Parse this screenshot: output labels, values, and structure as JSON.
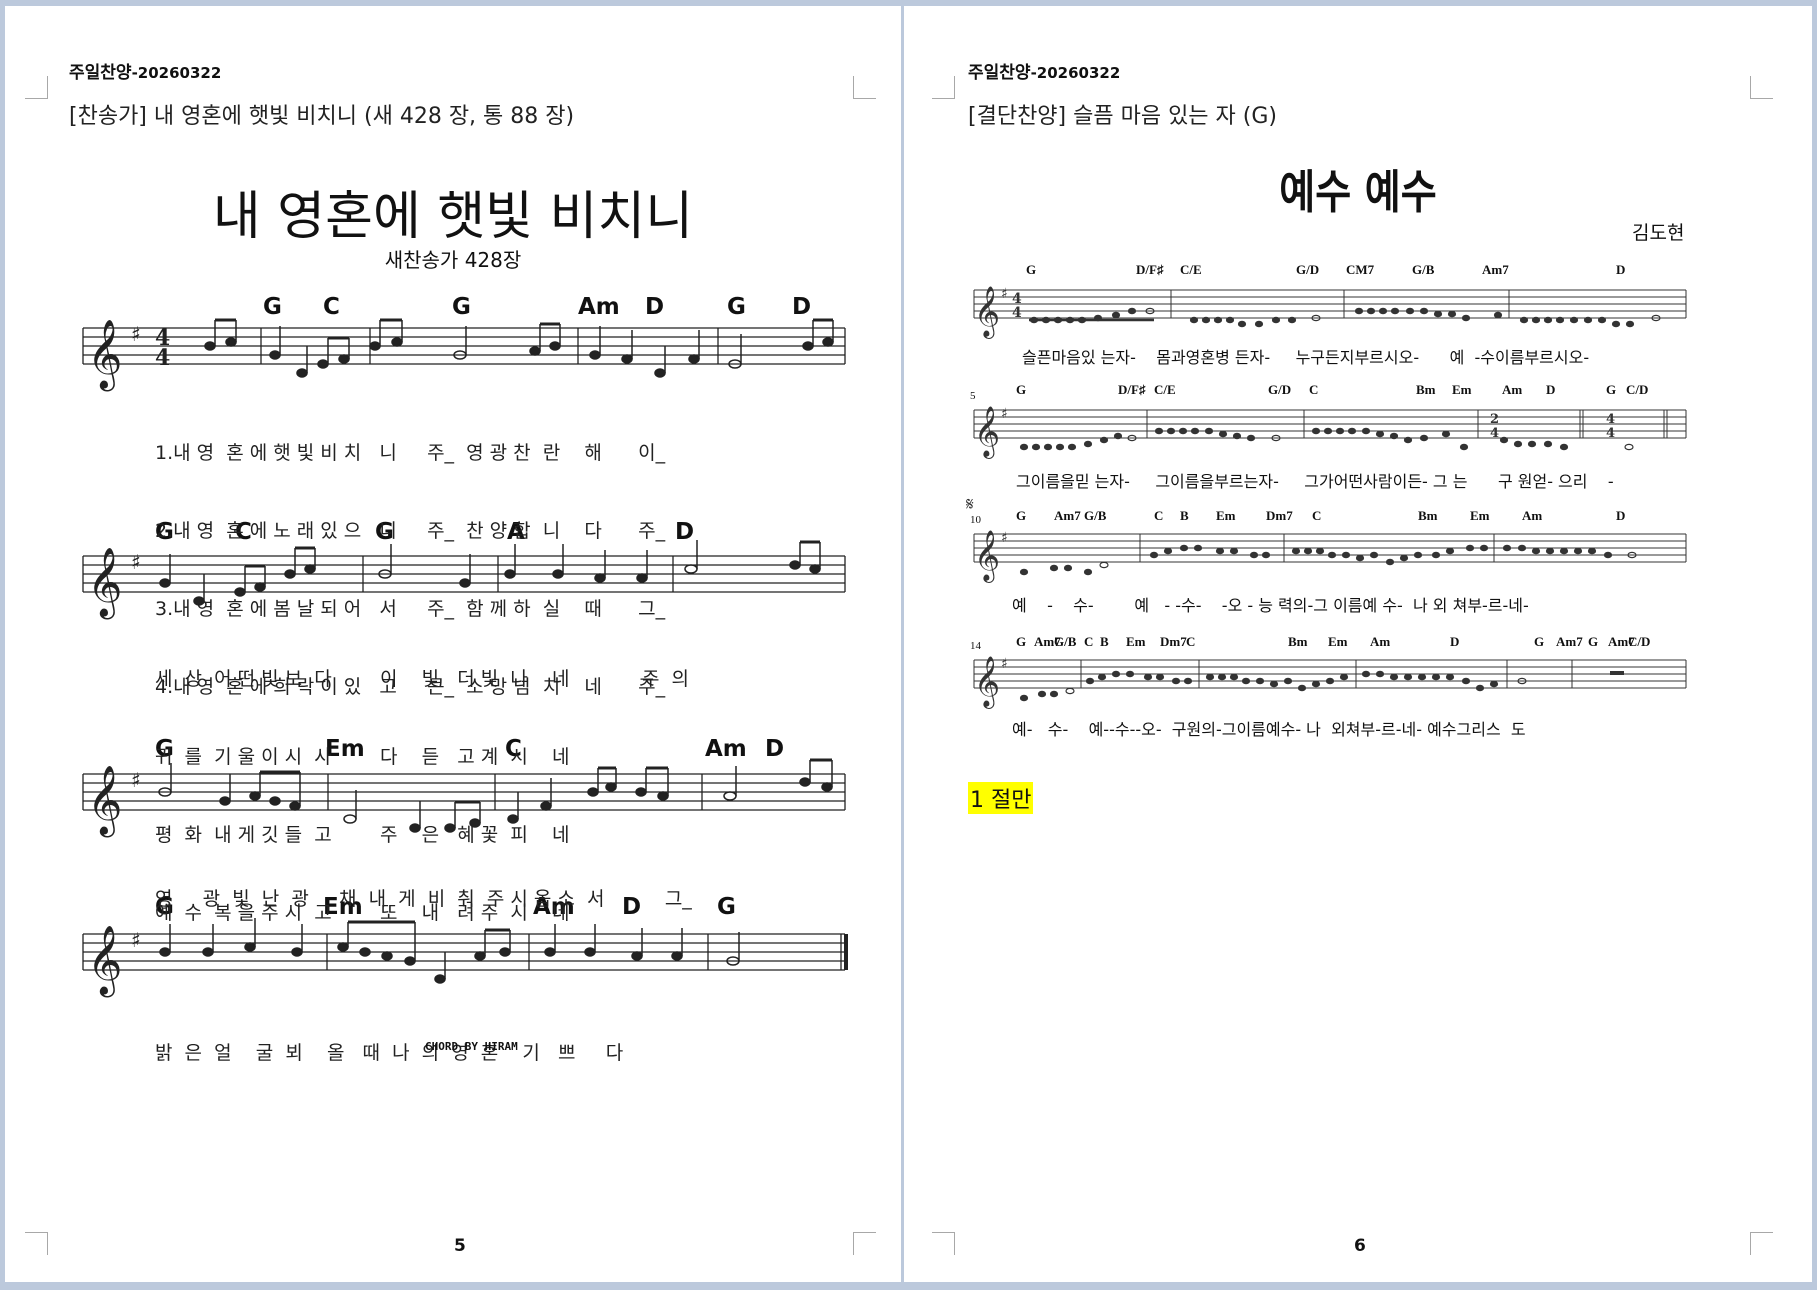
{
  "left_page": {
    "header_title": "주일찬양",
    "header_date": "-20260322",
    "subtitle": "[찬송가] 내 영혼에 햇빛 비치니 (새 428 장, 통 88 장)",
    "song_title": "내 영혼에 햇빛 비치니",
    "song_subtitle": "새찬송가 428장",
    "credit": "CHORD BY HIRAM",
    "page_number": "5",
    "systems": [
      {
        "chords": [
          "G",
          "C",
          "G",
          "Am",
          "D",
          "G",
          "D"
        ],
        "lyrics": [
          "1.내 영  혼 에 햇 빛 비 치   니     주_  영 광 찬  란    해      이_",
          "2.내 영  혼 에 노 래 있 으   니     주_  찬 양 합  니    다      주_",
          "3.내 영  혼 에 봄 날 되 어   서     주_  함 께 하  실    때      그_",
          "4.내 영  혼 에 희 락 이 있   고     큰_  소 망 넘  치    네      주_"
        ]
      },
      {
        "chords": [
          "G",
          "C",
          "G",
          "A",
          "D"
        ],
        "lyrics": [
          "세  상  어 떤 빛 보  다        이    빛   더 빛  나    네            주  의",
          "귀  를  기 울 이 시  사        다    듣   고 계  시    네",
          "평  화  내 게 깃 들  고        주    은   혜 꽃  피    네",
          "예  수  복 을 주 시  고        또    내   려 주  시    네"
        ]
      },
      {
        "chords": [
          "G",
          "Em",
          "C",
          "Am",
          "D"
        ],
        "lyrics": [
          "영     광  빛  난  광     채  내  게  비  춰  주 시 옵 소  서          그_"
        ]
      },
      {
        "chords": [
          "G",
          "Em",
          "Am",
          "D",
          "G"
        ],
        "lyrics": [
          "밝  은  얼    굴  뵈    올   때  나  의  영  혼    기   쁘     다"
        ]
      }
    ]
  },
  "right_page": {
    "header_title": "주일찬양",
    "header_date": "-20260322",
    "subtitle": "[결단찬양] 슬픔 마음 있는 자 (G)",
    "song_title": "예수 예수",
    "composer": "김도현",
    "page_number": "6",
    "highlight_note": "1 절만",
    "systems": [
      {
        "measure_number": "",
        "chords": [
          "G",
          "D/F♯",
          "C/E",
          "G/D",
          "CM7",
          "G/B",
          "Am7",
          "D"
        ],
        "lyrics": "슬픈마음있 는자-    몸과영혼병 든자-     누구든지부르시오-      예  -수이름부르시오-"
      },
      {
        "measure_number": "5",
        "chords": [
          "G",
          "D/F♯",
          "C/E",
          "G/D",
          "C",
          "Bm",
          "Em",
          "Am",
          "D",
          "G",
          "C/D"
        ],
        "lyrics": "그이름을믿 는자-     그이름을부르는자-     그가어떤사람이든- 그 는      구 원얻- 으리    -"
      },
      {
        "measure_number": "10",
        "chords": [
          "G",
          "Am7",
          "G/B",
          "C",
          "B",
          "Em",
          "Dm7",
          "C",
          "Bm",
          "Em",
          "Am",
          "D"
        ],
        "lyrics": "예    -    수-        예   - -수-    -오 - 능 력의-그 이름예 수-  나 외 쳐부-르-네-"
      },
      {
        "measure_number": "14",
        "chords": [
          "G",
          "Am7",
          "G/B",
          "C",
          "B",
          "Em",
          "Dm7",
          "C",
          "Bm",
          "Em",
          "Am",
          "D",
          "G",
          "Am7",
          "G",
          "Am7",
          "C/D"
        ],
        "lyrics": "예-   수-    예--수--오-  구원의-그이름예수- 나  외쳐부-르-네- 예수그리스  도"
      }
    ]
  }
}
